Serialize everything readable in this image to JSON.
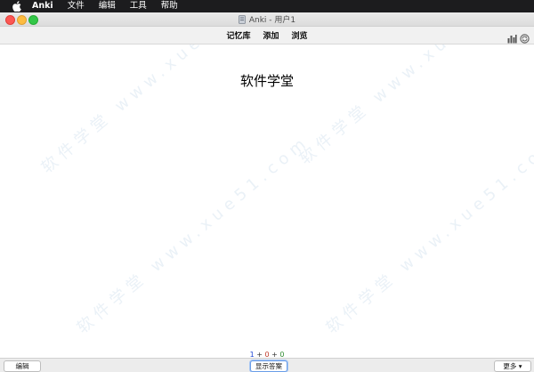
{
  "menubar": {
    "app_name": "Anki",
    "items": [
      "文件",
      "编辑",
      "工具",
      "帮助"
    ],
    "logo_icon": "apple-icon"
  },
  "window": {
    "title": "Anki - 用户1",
    "title_icon": "document-icon"
  },
  "toolbar": {
    "links": [
      "记忆库",
      "添加",
      "浏览"
    ],
    "right_icons": [
      "stats-icon",
      "sync-icon"
    ]
  },
  "card": {
    "question": "软件学堂"
  },
  "watermark": {
    "text": "软件学堂 www.xue51.com"
  },
  "counts": {
    "new": "1",
    "learning": "0",
    "review": "0",
    "separator": "+"
  },
  "bottom": {
    "edit_label": "编辑",
    "show_answer_label": "显示答案",
    "more_label": "更多 ▾"
  },
  "colors": {
    "new": "#1f47d6",
    "learning": "#c03a28",
    "review": "#2e8b2e"
  }
}
